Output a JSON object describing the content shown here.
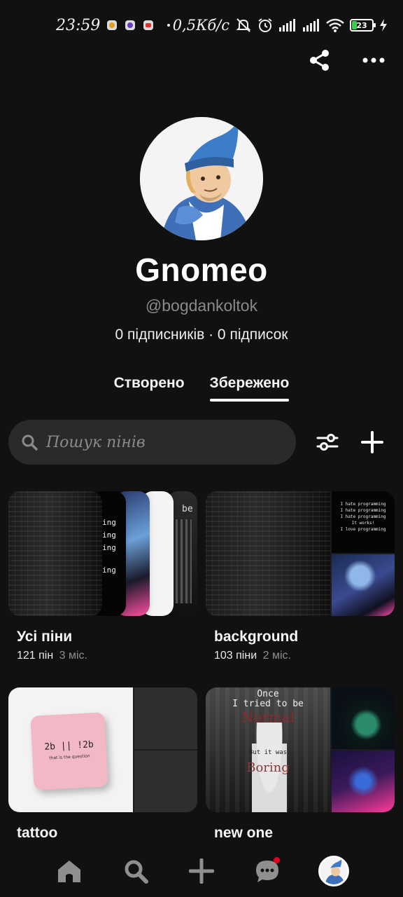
{
  "status_bar": {
    "time": "23:59",
    "speed": "0,5Кб/с",
    "battery": "23",
    "icons": [
      "app-notification-icon",
      "app-notification-icon",
      "youtube-icon",
      "mute-icon",
      "alarm-icon",
      "signal-icon",
      "signal-icon",
      "wifi-icon",
      "battery-icon",
      "charging-icon"
    ]
  },
  "top_actions": {
    "share_icon": "share-icon",
    "more_icon": "more-icon"
  },
  "profile": {
    "name": "Gnomeo",
    "handle": "@bogdankoltok",
    "stats": "0 підписників · 0 підписок"
  },
  "tabs": [
    {
      "label": "Створено",
      "active": false
    },
    {
      "label": "Збережено",
      "active": true
    }
  ],
  "search": {
    "placeholder": "Пошук пінів"
  },
  "boards": [
    {
      "title": "Усі піни",
      "count": "121 пін",
      "age": "3 міс."
    },
    {
      "title": "background",
      "count": "103 піни",
      "age": "2 міс."
    },
    {
      "title": "tattoo",
      "count": "",
      "age": "",
      "pillow_text_1": "2b || !2b",
      "pillow_text_2": "that is the question"
    },
    {
      "title": "new one",
      "count": "",
      "age": "",
      "cover_text_1": "Once",
      "cover_text_2": "I tried to be",
      "cover_text_3": "Normal",
      "cover_text_4": "But it was",
      "cover_text_5": "Boring"
    }
  ],
  "board1_card_lines": [
    "ing",
    "ing",
    "ing",
    "ing"
  ],
  "board1_card_be": "be",
  "board2_code_lines": [
    "I hate programming",
    "I hate programming",
    "I hate programming",
    "It works!",
    "I love programming"
  ],
  "bottom_nav": [
    "home-icon",
    "search-icon",
    "create-icon",
    "messages-icon",
    "profile-avatar"
  ],
  "colors": {
    "background": "#111111",
    "notification": "#e60023",
    "search_bg": "#2a2a2a",
    "muted_text": "#8a8a8a"
  }
}
